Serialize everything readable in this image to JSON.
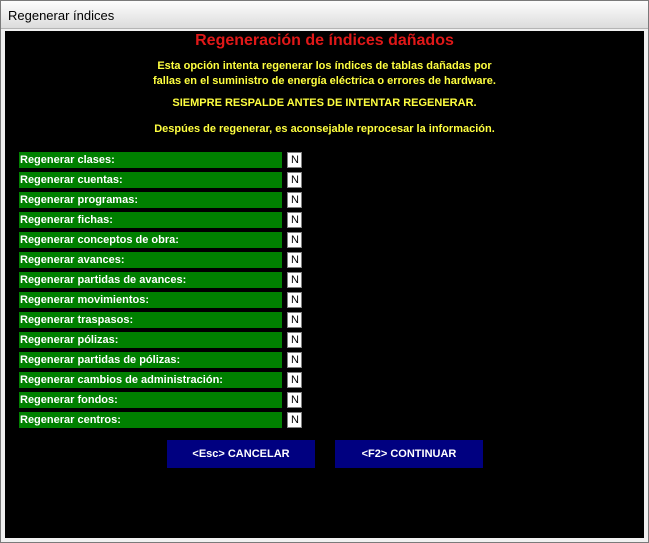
{
  "window": {
    "title": "Regenerar índices"
  },
  "main": {
    "heading": "Regeneración de índices dañados",
    "info_line1": "Esta opción intenta regenerar los índices de tablas dañadas por",
    "info_line2": "fallas en el suministro de energía eléctrica o errores de hardware.",
    "warning": "SIEMPRE RESPALDE ANTES DE INTENTAR REGENERAR.",
    "note": "Despúes de regenerar, es aconsejable reprocesar la información."
  },
  "options": [
    {
      "label": "Regenerar clases:",
      "value": "N"
    },
    {
      "label": "Regenerar cuentas:",
      "value": "N"
    },
    {
      "label": "Regenerar programas:",
      "value": "N"
    },
    {
      "label": "Regenerar fichas:",
      "value": "N"
    },
    {
      "label": "Regenerar conceptos de obra:",
      "value": "N"
    },
    {
      "label": "Regenerar avances:",
      "value": "N"
    },
    {
      "label": "Regenerar partidas de avances:",
      "value": "N"
    },
    {
      "label": "Regenerar movimientos:",
      "value": "N"
    },
    {
      "label": "Regenerar traspasos:",
      "value": "N"
    },
    {
      "label": "Regenerar pólizas:",
      "value": "N"
    },
    {
      "label": "Regenerar partidas de pólizas:",
      "value": "N"
    },
    {
      "label": "Regenerar cambios de administración:",
      "value": "N"
    },
    {
      "label": "Regenerar fondos:",
      "value": "N"
    },
    {
      "label": "Regenerar centros:",
      "value": "N"
    }
  ],
  "buttons": {
    "cancel": "<Esc> CANCELAR",
    "continue": "<F2> CONTINUAR"
  },
  "colors": {
    "heading": "#e01818",
    "info_text": "#ffff40",
    "label_bg": "#008000",
    "button_bg": "#000080",
    "background": "#000000"
  }
}
